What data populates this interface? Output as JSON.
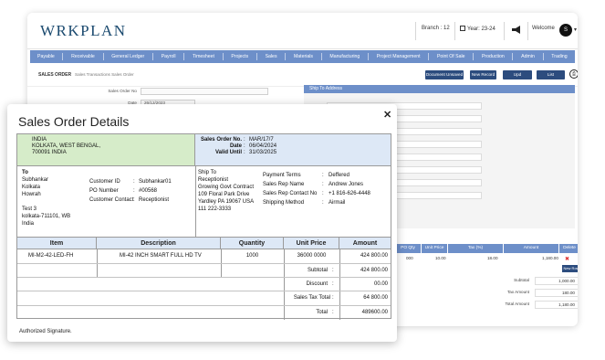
{
  "app": {
    "logo": "WRKPLAN",
    "branch": "Branch : 12",
    "year": "Year: 23-24",
    "welcome": "Welcome",
    "avatar_initial": "S",
    "nav": [
      "Payable",
      "Receivable",
      "General Ledger",
      "Payroll",
      "Timesheet",
      "Projects",
      "Sales",
      "Materials",
      "Manufacturing",
      "Project Management",
      "Point Of Sale",
      "Production",
      "Admin",
      "Trading"
    ],
    "page_title": "SALES ORDER",
    "breadcrumb": "Sales Transactions Sales Order",
    "buttons": {
      "unsaved": "Document Unsaved",
      "new_record": "New Record",
      "update": "Upd",
      "list": "List"
    },
    "form": {
      "sales_order_no_label": "Sales Order No",
      "date_label": "Date",
      "date_value": "26/12/2023"
    },
    "ship_to_panel": "Ship To Address",
    "grid_headers": [
      "PO Qty",
      "Unit Price",
      "Tax (%)",
      "Amount",
      "Delete"
    ],
    "grid_row": {
      "qty": "000",
      "unit_price": "10.00",
      "tax": "18.00",
      "amount": "1,180.00"
    },
    "new_row": "New Row",
    "summary": [
      {
        "label": "Subtotal",
        "value": "1,000.00"
      },
      {
        "label": "Tax Amount",
        "value": "180.00"
      },
      {
        "label": "Total Amount",
        "value": "1,180.00"
      }
    ]
  },
  "modal": {
    "title": "Sales Order Details",
    "bill_address": [
      "INDIA",
      "KOLKATA, WEST BENGAL,",
      "700091 INDIA"
    ],
    "order_meta": [
      {
        "label": "Sales Order No.",
        "value": "MAR/17/7"
      },
      {
        "label": "Date",
        "value": "06/04/2024"
      },
      {
        "label": "Valid Until",
        "value": "31/03/2025"
      }
    ],
    "to": {
      "heading": "To",
      "lines": [
        "Subhankar",
        "Kolkata",
        "Howrah",
        "",
        "Test 3",
        "kolkata-711101, WB",
        "India"
      ]
    },
    "customer": [
      {
        "label": "Customer ID",
        "value": "Subhankar01"
      },
      {
        "label": "PO Number",
        "value": "#00568"
      },
      {
        "label": "Customer Contact",
        "value": "Receptionist"
      }
    ],
    "ship_to": {
      "heading": "Ship To",
      "lines": [
        "Receptionist",
        "Growing Govt Contract",
        "109 Floral Park Drive",
        "Yardley PA 19067 USA",
        "111 222-3333"
      ]
    },
    "terms": [
      {
        "label": "Payment Terms",
        "value": "Deffered"
      },
      {
        "label": "Sales Rep Name",
        "value": "Andrew Jones"
      },
      {
        "label": "Sales Rep Contact No",
        "value": "+1 816-626-4448"
      },
      {
        "label": "Shipping Method",
        "value": "Airmail"
      }
    ],
    "items": {
      "headers": {
        "item": "Item",
        "description": "Description",
        "quantity": "Quantity",
        "unit_price": "Unit Price",
        "amount": "Amount"
      },
      "rows": [
        {
          "item": "MI-M2-42-LED-FH",
          "description": "MI-42 INCH SMART FULL HD TV",
          "quantity": "1000",
          "unit_price": "36000 0000",
          "amount": "424 800.00"
        }
      ]
    },
    "totals": [
      {
        "label": "Subtotal",
        "value": "424 800.00"
      },
      {
        "label": "Discount",
        "value": "00.00"
      },
      {
        "label": "Sales Tax Total",
        "value": "64 800.00"
      },
      {
        "label": "Total",
        "value": "489600.00"
      }
    ],
    "signature": "Authorized Signature."
  }
}
